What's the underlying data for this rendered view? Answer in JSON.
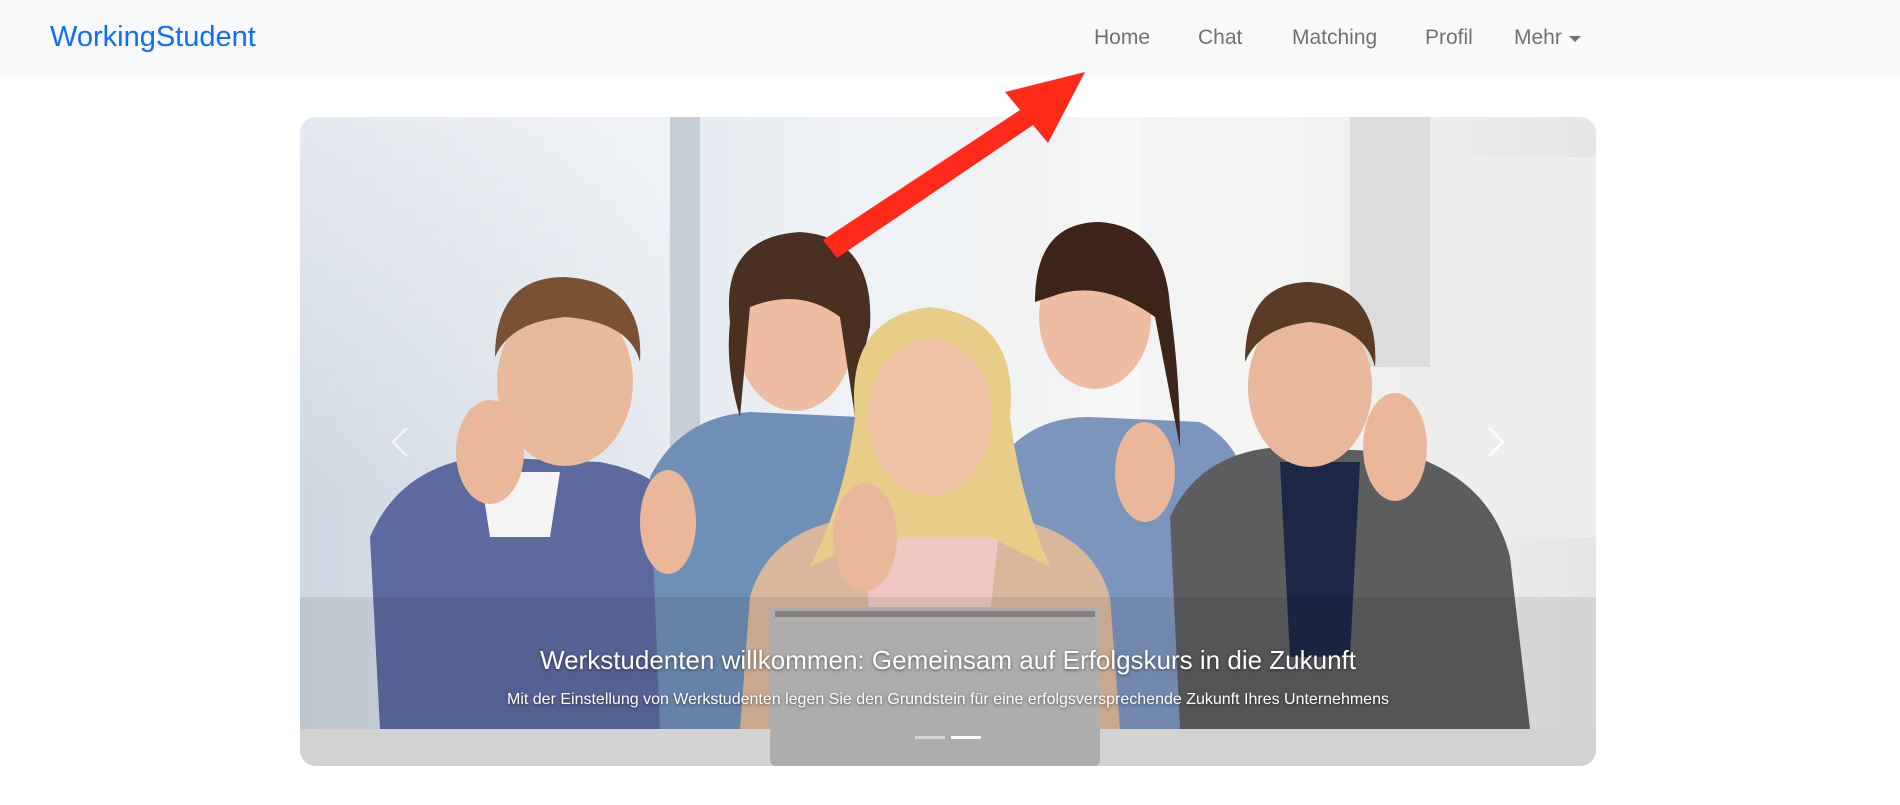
{
  "navbar": {
    "brand": "WorkingStudent",
    "links": [
      {
        "label": "Home"
      },
      {
        "label": "Chat"
      },
      {
        "label": "Matching"
      },
      {
        "label": "Profil"
      },
      {
        "label": "Mehr"
      }
    ]
  },
  "carousel": {
    "image_alt": "Fünf lächelnde Studenten zeigen den Daumen nach oben",
    "caption_title": "Werkstudenten willkommen: Gemeinsam auf Erfolgskurs in die Zukunft",
    "caption_text": "Mit der Einstellung von Werkstudenten legen Sie den Grundstein für eine erfolgsversprechende Zukunft Ihres Unternehmens",
    "slide_count": 2,
    "active_slide": 2,
    "prev_icon": "chevron-left-icon",
    "next_icon": "chevron-right-icon"
  },
  "colors": {
    "brand": "#0d6efd",
    "navbar_bg": "#f8f9fa",
    "annotation_arrow": "#ff2a1a"
  }
}
